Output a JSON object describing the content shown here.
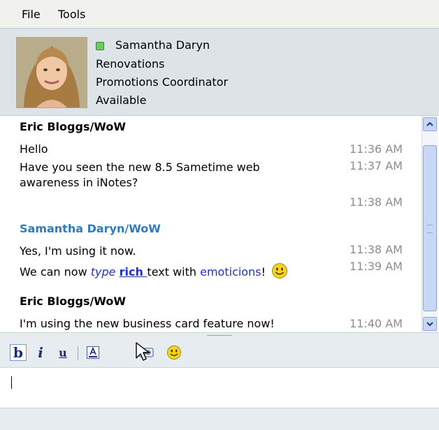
{
  "menu": {
    "file": "File",
    "tools": "Tools"
  },
  "contact": {
    "name": "Samantha Daryn",
    "department": "Renovations",
    "title": "Promotions Coordinator",
    "status": "Available",
    "status_color": "#6ccb5b"
  },
  "messages": {
    "sender1": "Eric Bloggs/WoW",
    "m1_text": "Hello",
    "m1_time": "11:36 AM",
    "m2_line1": "Have you seen the new 8.5 Sametime web",
    "m2_line2": "awareness in iNotes?",
    "m2_time": "11:37 AM",
    "m3_time": "11:38 AM",
    "sender2": "Samantha Daryn/WoW",
    "m4_text": "Yes, I'm using it now.",
    "m4_time": "11:38 AM",
    "m5_a": "We can now ",
    "m5_b": "type",
    "m5_c": " ",
    "m5_d": "rich ",
    "m5_e": "text with ",
    "m5_f": "emoticions",
    "m5_g": "!",
    "m5_time": "11:39 AM",
    "sender3": "Eric Bloggs/WoW",
    "m6_text": "I'm using the new business card feature now!",
    "m6_time": "11:40 AM"
  },
  "toolbar": {
    "bold": "b",
    "italic": "i",
    "underline": "u"
  },
  "icons": {
    "bold": "bold-icon",
    "italic": "italic-icon",
    "underline": "underline-icon",
    "font_color": "font-color-icon",
    "link": "link-icon",
    "emoticon": "smiley-icon",
    "cursor": "mouse-pointer-icon"
  },
  "colors": {
    "sender_other": "#2f7bc2",
    "rich_text": "#1f32c8",
    "timestamp": "#8c8c8c"
  }
}
